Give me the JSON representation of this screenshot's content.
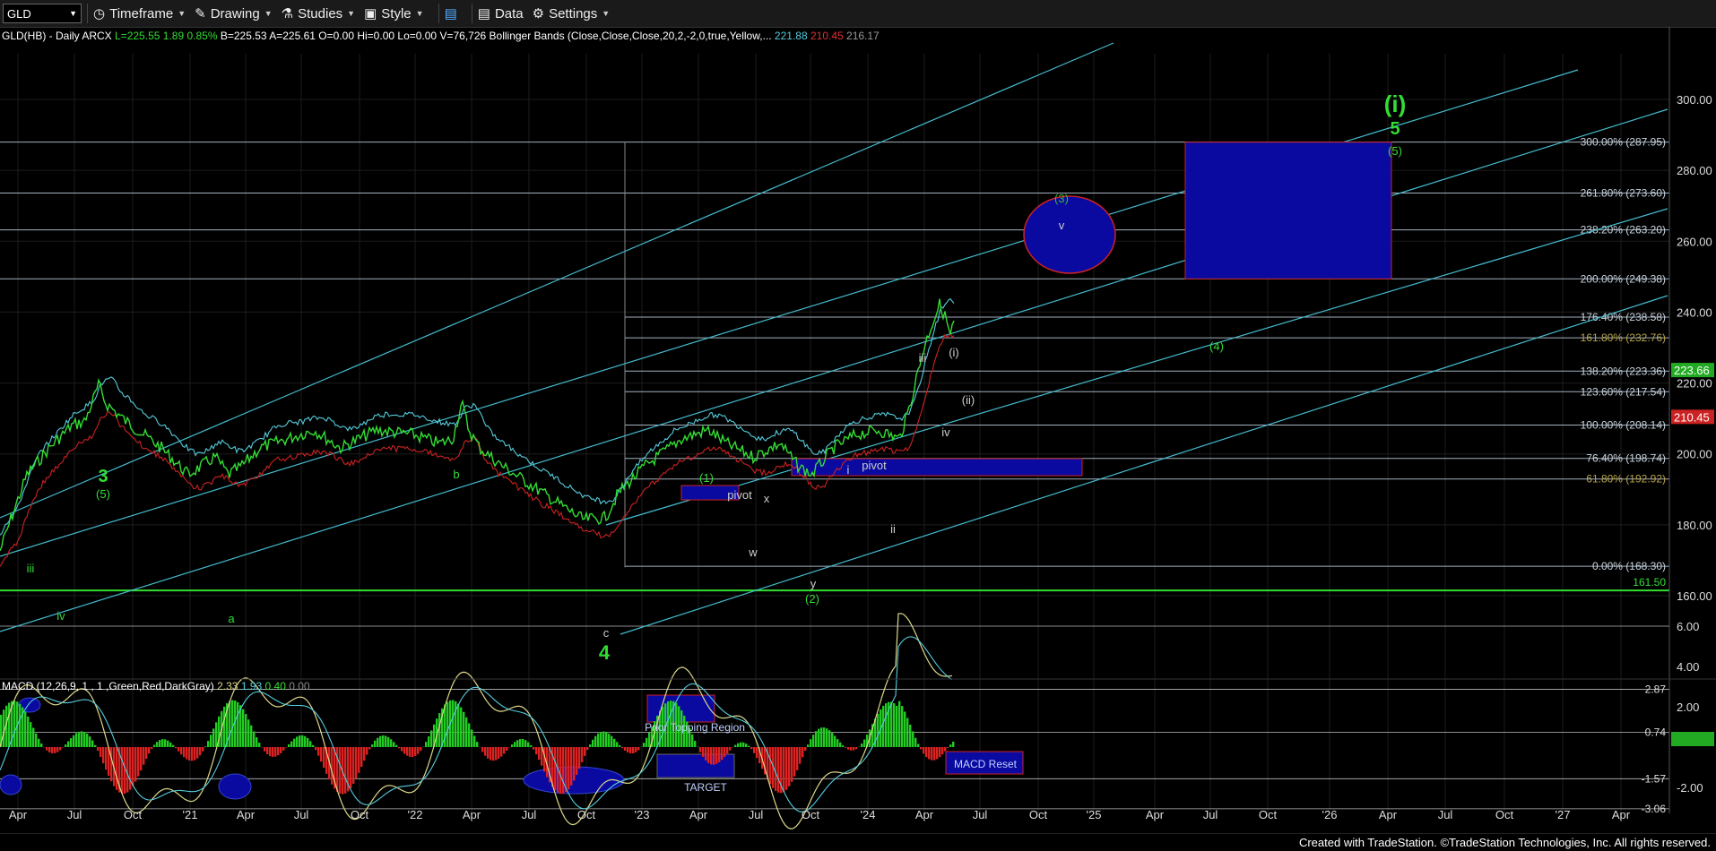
{
  "toolbar": {
    "symbol": "GLD",
    "timeframe": "Timeframe",
    "drawing": "Drawing",
    "studies": "Studies",
    "style": "Style",
    "data": "Data",
    "settings": "Settings"
  },
  "info": {
    "prefix": "GLD(HB) - Daily  ARCX",
    "last": "L=225.55",
    "chg": "1.89",
    "pct": "0.85%",
    "bid": "B=225.53",
    "ask": "A=225.61",
    "open": "O=0.00",
    "hi": "Hi=0.00",
    "lo": "Lo=0.00",
    "vol": "V=76,726",
    "bb": "Bollinger Bands (Close,Close,Close,20,2,-2,0,true,Yellow,...",
    "bb1": "221.88",
    "bb2": "210.45",
    "bb3": "216.17"
  },
  "macd_info": {
    "label": "MACD (12,26,9, 1 , 1 ,Green,Red,DarkGray)",
    "v1": "2.33",
    "v2": "1.93",
    "v3": "0.40",
    "v4": "0.00"
  },
  "footer": "Created with TradeStation. ©TradeStation Technologies, Inc. All rights reserved.",
  "colors": {
    "price": "#33dd33",
    "upper_band": "#55ccdd",
    "lower_band": "#cc2222",
    "channel": "#44bbcc",
    "fib_line": "#c0d0e0",
    "box_fill": "#0a0aa0",
    "box_stroke": "#cc2222",
    "green_label": "#33cc33"
  },
  "chart_data": {
    "type": "line",
    "title": "GLD(HB) - Daily",
    "ylim": [
      140,
      320
    ],
    "x_ticks": [
      "Apr",
      "Jul",
      "Oct",
      "'21",
      "Apr",
      "Jul",
      "Oct",
      "'22",
      "Apr",
      "Jul",
      "Oct",
      "'23",
      "Apr",
      "Jul",
      "Oct",
      "'24",
      "Apr",
      "Jul",
      "Oct",
      "'25",
      "Apr",
      "Jul",
      "Oct",
      "'26",
      "Apr",
      "Jul",
      "Oct",
      "'27",
      "Apr"
    ],
    "y_ticks": [
      "300.00",
      "280.00",
      "260.00",
      "240.00",
      "220.00",
      "200.00",
      "180.00",
      "160.00"
    ],
    "price_labels": [
      {
        "text": "223.66",
        "value": 223.66,
        "bg": "#22aa22"
      },
      {
        "text": "210.45",
        "value": 210.45,
        "bg": "#cc2222"
      }
    ],
    "fib_levels": [
      {
        "label": "300.00% (287.95)",
        "value": 287.95
      },
      {
        "label": "261.80% (273.60)",
        "value": 273.6
      },
      {
        "label": "238.20% (263.20)",
        "value": 263.2
      },
      {
        "label": "200.00% (249.38)",
        "value": 249.38
      },
      {
        "label": "176.40% (238.58)",
        "value": 238.58
      },
      {
        "label": "161.80% (232.76)",
        "value": 232.76
      },
      {
        "label": "138.20% (223.36)",
        "value": 223.36
      },
      {
        "label": "123.60% (217.54)",
        "value": 217.54
      },
      {
        "label": "100.00% (208.14)",
        "value": 208.14
      },
      {
        "label": "76.40% (198.74)",
        "value": 198.74
      },
      {
        "label": "61.80% (192.92)",
        "value": 192.92
      },
      {
        "label": "0.00% (168.30)",
        "value": 168.3
      }
    ],
    "support_line": {
      "label": "161.50",
      "value": 161.5
    },
    "wave_labels": [
      {
        "text": "(i)",
        "big": true
      },
      {
        "text": "5",
        "big": true
      },
      {
        "text": "(5)"
      },
      {
        "text": "3",
        "big": true
      },
      {
        "text": "(5)"
      },
      {
        "text": "4",
        "big": true
      },
      {
        "text": "(3)"
      },
      {
        "text": "v"
      },
      {
        "text": "(4)"
      },
      {
        "text": "(1)"
      },
      {
        "text": "(2)"
      },
      {
        "text": "iii"
      },
      {
        "text": "(i)"
      },
      {
        "text": "(ii)"
      },
      {
        "text": "iv"
      },
      {
        "text": "i"
      },
      {
        "text": "ii"
      },
      {
        "text": "pivot"
      },
      {
        "text": "pivot"
      },
      {
        "text": "x"
      },
      {
        "text": "w"
      },
      {
        "text": "y"
      },
      {
        "text": "b"
      },
      {
        "text": "a"
      },
      {
        "text": "c"
      },
      {
        "text": "iii"
      },
      {
        "text": "iv"
      }
    ],
    "macd": {
      "y_ticks": [
        "6.00",
        "4.00",
        "2.00",
        "0.40",
        "-2.00"
      ],
      "levels": [
        "2.87",
        "0.74",
        "-1.57",
        "-3.06"
      ],
      "annotations": [
        "Prior Topping Region",
        "TARGET",
        "MACD Reset"
      ]
    }
  }
}
